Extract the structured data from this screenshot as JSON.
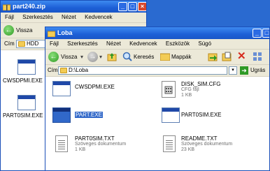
{
  "back_window": {
    "title": "part240.zip",
    "menu": [
      "Fájl",
      "Szerkesztés",
      "Nézet",
      "Kedvencek"
    ],
    "back_label": "Vissza",
    "address_label": "Cím",
    "address_value": "HDD",
    "items": [
      "CWSDPMI.EXE",
      "PART0SIM.EXE"
    ]
  },
  "front_window": {
    "title": "Loba",
    "menu": [
      "Fájl",
      "Szerkesztés",
      "Nézet",
      "Kedvencek",
      "Eszközök",
      "Súgó"
    ],
    "toolbar": {
      "back_label": "Vissza",
      "search_label": "Keresés",
      "folders_label": "Mappák"
    },
    "address_label": "Cím",
    "address_value": "D:\\Loba",
    "go_label": "Ugrás",
    "files": [
      {
        "name": "CWSDPMI.EXE",
        "type": "",
        "size": ""
      },
      {
        "name": "DISK_SIM.CFG",
        "type": "CFG fájl",
        "size": "1 KB"
      },
      {
        "name": "PART.EXE",
        "type": "",
        "size": ""
      },
      {
        "name": "PART0SIM.EXE",
        "type": "",
        "size": ""
      },
      {
        "name": "PART0SIM.TXT",
        "type": "Szöveges dokumentum",
        "size": "1 KB"
      },
      {
        "name": "README.TXT",
        "type": "Szöveges dokumentum",
        "size": "23 KB"
      }
    ]
  }
}
